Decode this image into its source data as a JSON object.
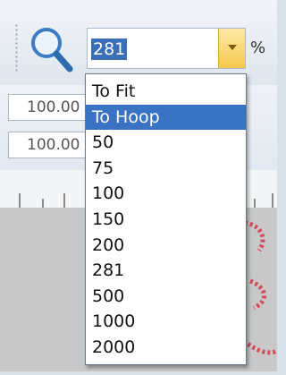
{
  "toolbar": {
    "zoom_value": "281",
    "percent_symbol": "%",
    "zoom_icon": "magnifier-icon",
    "dropdown_arrow_icon": "chevron-down-icon"
  },
  "fields": {
    "width_value": "100.00",
    "height_value": "100.00"
  },
  "zoom_menu": {
    "options": [
      "To Fit",
      "To Hoop",
      "50",
      "75",
      "100",
      "150",
      "200",
      "281",
      "500",
      "1000",
      "2000"
    ],
    "selected": "To Hoop"
  },
  "colors": {
    "accent": "#3a73c4",
    "button_yellow": "#f5c84c",
    "stitch_red": "#d84a5a"
  }
}
